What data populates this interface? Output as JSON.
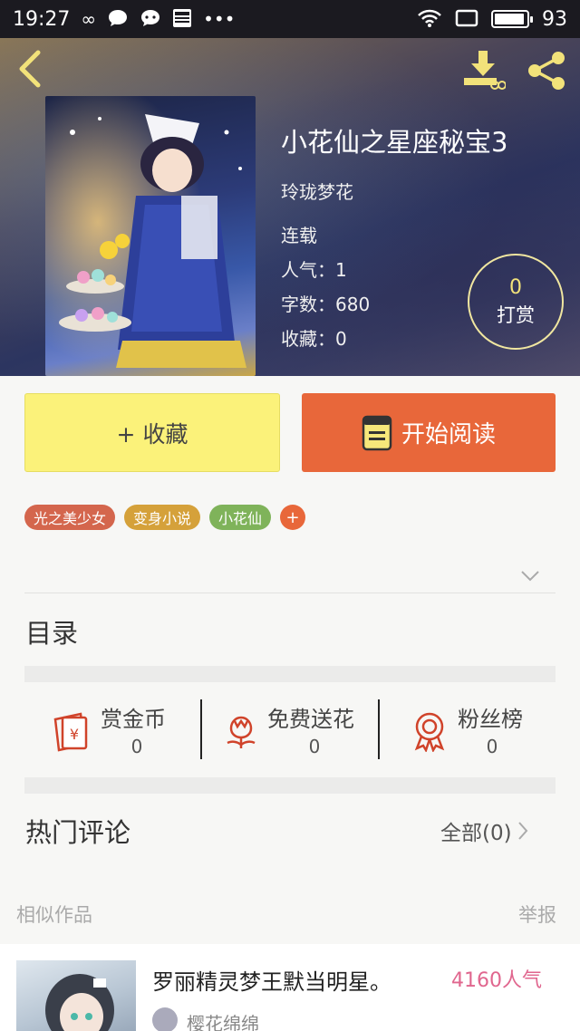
{
  "status_bar": {
    "time": "19:27",
    "battery": "93",
    "battery_level": 0.93,
    "left_icons": [
      "infinity-icon",
      "chat-bubble-icon",
      "message-icon",
      "news-icon",
      "more-dots-icon"
    ],
    "right_icons": [
      "wifi-icon",
      "screen-icon",
      "battery-icon"
    ]
  },
  "header": {
    "back_icon": "chevron-left-icon",
    "download_icon": "download-icon",
    "share_icon": "share-icon",
    "icon_color": "#f2e27a"
  },
  "book": {
    "title": "小花仙之星座秘宝3",
    "author": "玲珑梦花",
    "status": "连载",
    "popularity": "人气：1",
    "word_count": "字数：680",
    "favorites": "收藏：0",
    "tip": {
      "count": "0",
      "label": "打赏"
    }
  },
  "actions": {
    "collect_label": "+ 收藏",
    "read_label": "开始阅读",
    "collect_color": "#fbf27a",
    "read_color": "#e8673a"
  },
  "tags": [
    {
      "label": "光之美少女",
      "color": "#d4664d"
    },
    {
      "label": "变身小说",
      "color": "#d5a13a"
    },
    {
      "label": "小花仙",
      "color": "#7fb35a"
    }
  ],
  "tag_add_label": "+",
  "toc": {
    "title": "目录"
  },
  "support": [
    {
      "label": "赏金币",
      "value": "0",
      "icon": "red-envelope-icon"
    },
    {
      "label": "免费送花",
      "value": "0",
      "icon": "flower-icon"
    },
    {
      "label": "粉丝榜",
      "value": "0",
      "icon": "medal-icon"
    }
  ],
  "comments": {
    "title": "热门评论",
    "all_label": "全部(0)"
  },
  "similar": {
    "section_label": "相似作品",
    "report_label": "举报",
    "items": [
      {
        "title": "罗丽精灵梦王默当明星。",
        "popularity": "4160人气",
        "author": "樱花绵绵"
      }
    ]
  }
}
